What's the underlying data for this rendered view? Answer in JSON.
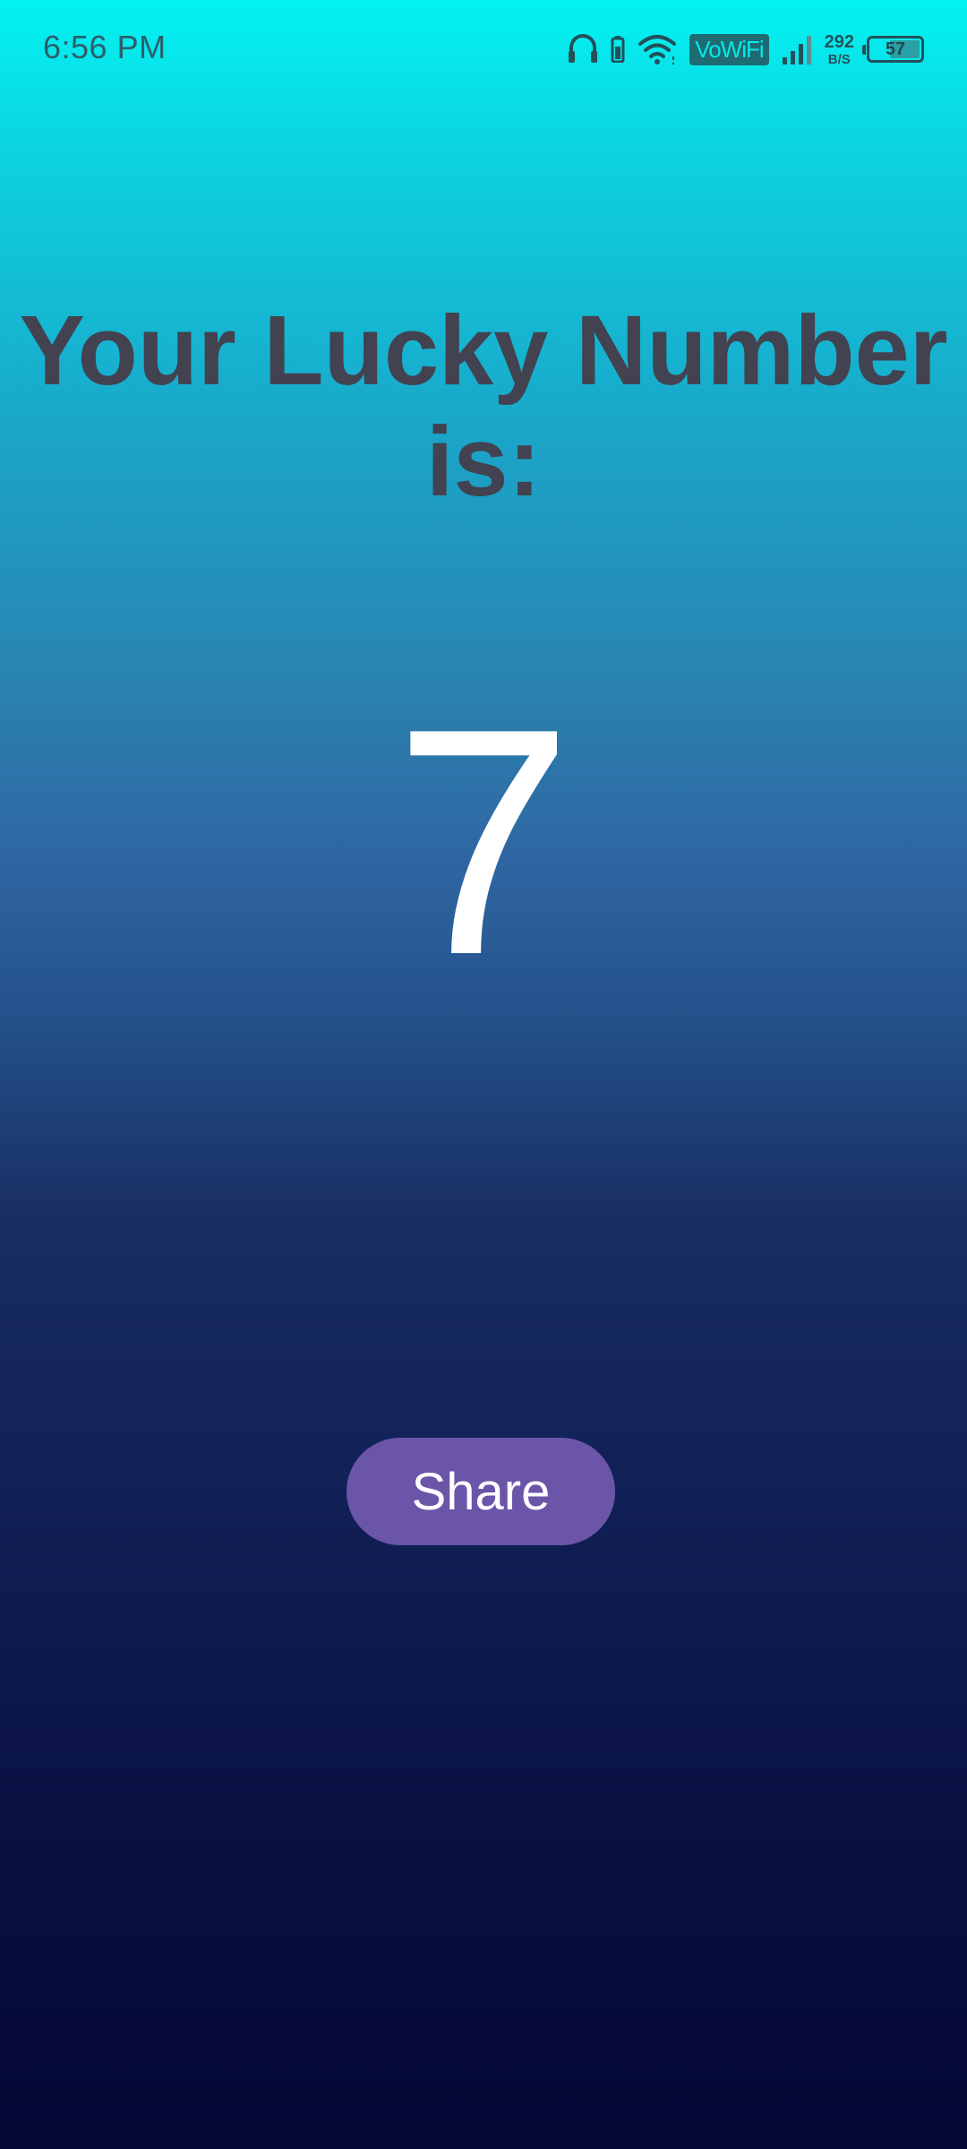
{
  "status_bar": {
    "time": "6:56 PM",
    "vowifi_label": "VoWiFi",
    "network_speed_value": "292",
    "network_speed_unit": "B/S",
    "battery_level": "57",
    "icons": [
      "headphones-icon",
      "phone-battery-icon",
      "wifi-icon",
      "vowifi-badge",
      "cellular-signal-icon",
      "battery-icon"
    ]
  },
  "main": {
    "title": "Your Lucky Number is:",
    "lucky_number": "7",
    "share_label": "Share"
  },
  "colors": {
    "gradient_top": "#03f3f2",
    "gradient_bottom": "#030734",
    "title_text": "#424250",
    "number_text": "#ffffff",
    "share_button_bg": "#6a55a8"
  }
}
